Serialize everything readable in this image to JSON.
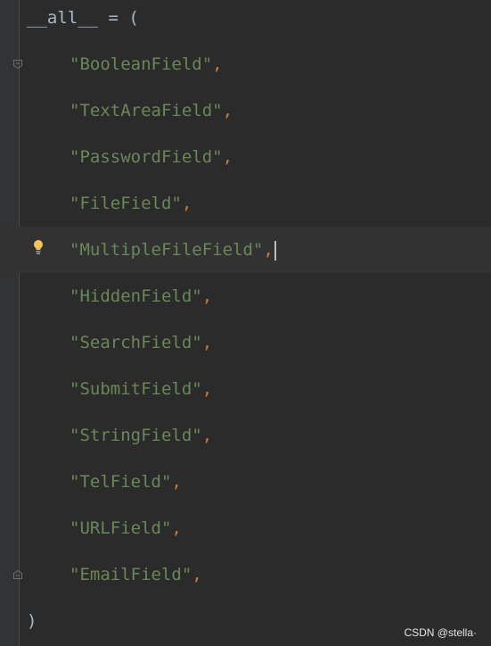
{
  "editor": {
    "header_code": "__all__ = (",
    "closing_code": ")",
    "items": [
      "\"BooleanField\"",
      "\"TextAreaField\"",
      "\"PasswordField\"",
      "\"FileField\"",
      "\"MultipleFileField\"",
      "\"HiddenField\"",
      "\"SearchField\"",
      "\"SubmitField\"",
      "\"StringField\"",
      "\"TelField\"",
      "\"URLField\"",
      "\"EmailField\""
    ],
    "separator": ","
  },
  "icons": {
    "intention_bulb": "lightbulb-icon",
    "fold_marker": "fold-icon"
  },
  "colors": {
    "background": "#2b2b2b",
    "gutter": "#313335",
    "current_line": "#323232",
    "string": "#6a8759",
    "punctuation": "#cc7832",
    "plain": "#a9b7c6",
    "bulb": "#f2c55c"
  },
  "watermark": "CSDN @stella·"
}
